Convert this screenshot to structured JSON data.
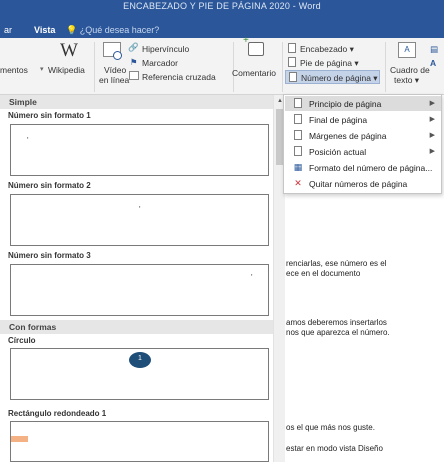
{
  "window": {
    "title": "ENCABEZADO Y PIE DE PÁGINA 2020 - Word"
  },
  "menubar": {
    "items": [
      {
        "label": "ar"
      },
      {
        "label": "Vista"
      }
    ],
    "tell_me": "¿Qué desea hacer?"
  },
  "ribbon": {
    "mentos": "mentos",
    "wikipedia": "Wikipedia",
    "video_line1": "Vídeo",
    "video_line2": "en línea",
    "hipervinculo": "Hipervínculo",
    "marcador": "Marcador",
    "referencia": "Referencia cruzada",
    "comentario": "Comentario",
    "encabezado": "Encabezado ▾",
    "pie": "Pie de página ▾",
    "numero": "Número de página ▾",
    "cuadro_line1": "Cuadro de",
    "cuadro_line2": "texto ▾"
  },
  "gallery": {
    "header_simple": "Simple",
    "header_formas": "Con formas",
    "items": [
      {
        "label": "Número sin formato 1",
        "num": "'"
      },
      {
        "label": "Número sin formato 2",
        "num": "'"
      },
      {
        "label": "Número sin formato 3",
        "num": "'"
      },
      {
        "label": "Círculo",
        "num": "1"
      },
      {
        "label": "Rectángulo redondeado 1"
      }
    ]
  },
  "menu": {
    "items": [
      {
        "label": "Principio de página",
        "submenu": true
      },
      {
        "label": "Final de página",
        "submenu": true
      },
      {
        "label": "Márgenes de página",
        "submenu": true
      },
      {
        "label": "Posición actual",
        "submenu": true
      },
      {
        "label": "Formato del número de página...",
        "submenu": false
      },
      {
        "label": "Quitar números de página",
        "submenu": false
      }
    ]
  },
  "document": {
    "lines": [
      "renciarlas, ese número es el",
      "ece en el documento",
      "amos deberemos insertarlos",
      "nos que aparezca el número.",
      "os el que más nos guste.",
      "estar en modo vista Diseño"
    ]
  },
  "colors": {
    "accent": "#2b579a",
    "circle": "#1f4e79",
    "rect": "#f4b183"
  }
}
